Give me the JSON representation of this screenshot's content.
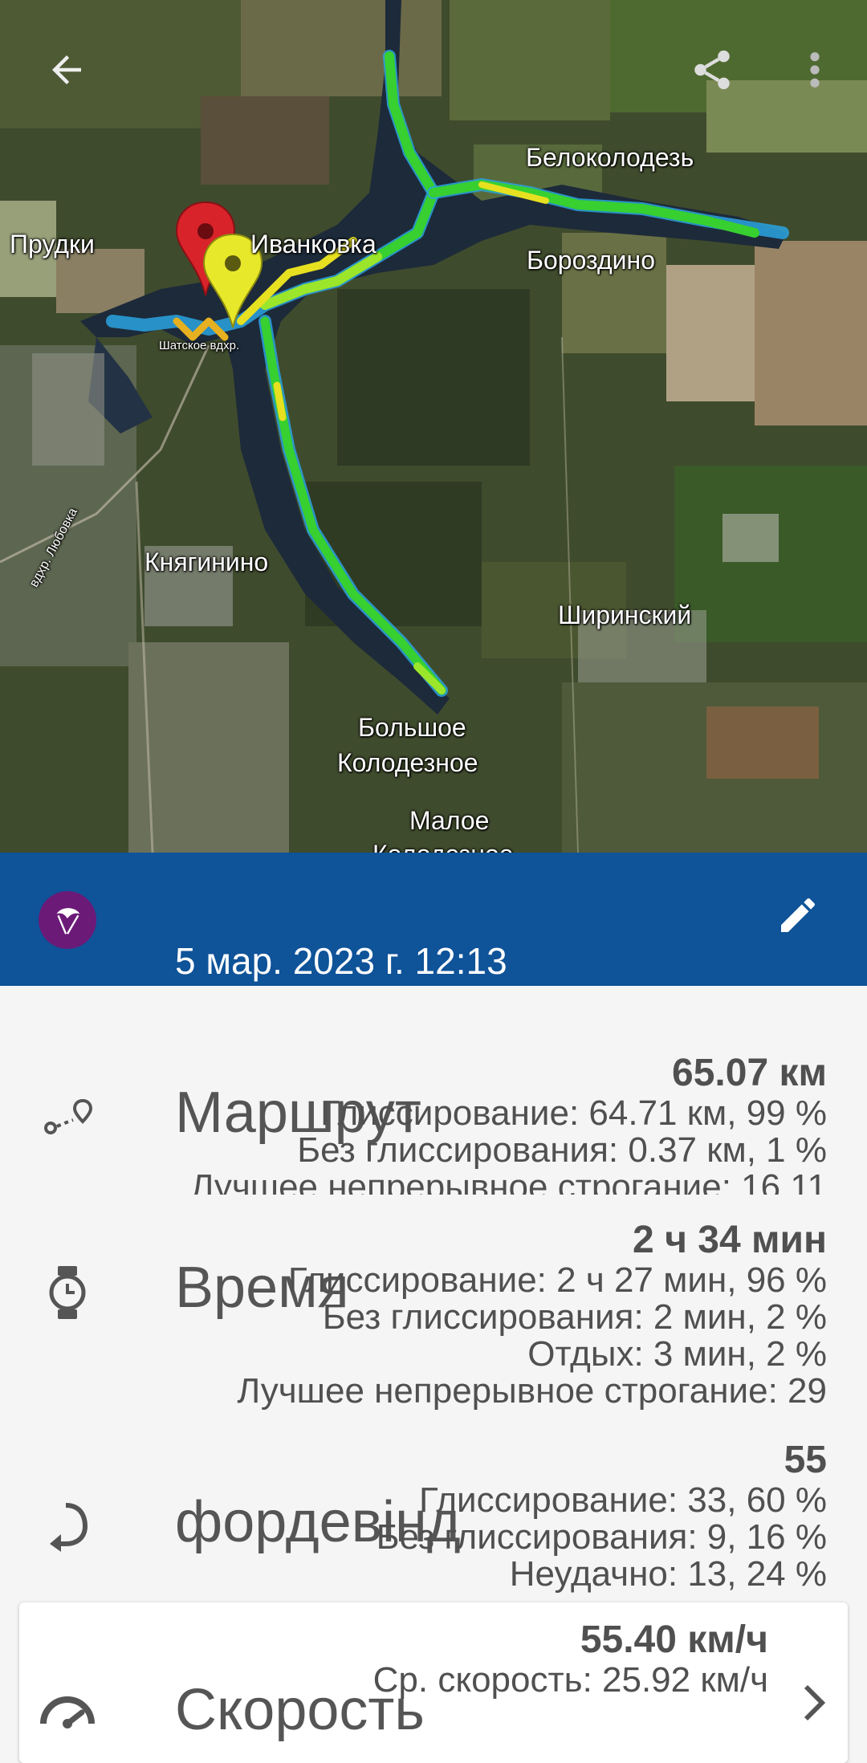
{
  "map": {
    "labels": {
      "prudki": "Прудки",
      "ivanovka": "Иванковка",
      "belokolodez": "Белоколодезь",
      "borozdino": "Бороздино",
      "shatskoe": "Шатское вдхр.",
      "knyaginino": "Княгинино",
      "shirinsky": "Ширинский",
      "bolshoe1": "Большое",
      "bolshoe2": "Колодезное",
      "maloe1": "Малое",
      "maloe2": "Колодезное",
      "lyubovka": "вдхр. Любовка"
    },
    "icons": {
      "back": "arrow-back-icon",
      "share": "share-icon",
      "menu": "more-vert-icon",
      "start_marker": "red-pin-icon",
      "end_marker": "yellow-pin-icon"
    },
    "track_colors": [
      "#2aa3e0",
      "#37d030",
      "#e6e020",
      "#9be62a"
    ]
  },
  "session": {
    "date": "5 мар. 2023 г. 12:13",
    "bar_color": "#0f5399",
    "avatar_icon": "kite-icon",
    "edit_icon": "pencil-icon"
  },
  "stats": {
    "route": {
      "title": "Маршрут",
      "icon": "route-icon",
      "main": "65.07 км",
      "lines": [
        "Глиссирование: 64.71 км, 99 %",
        "Без глиссирования: 0.37 км, 1 %",
        "Лучшее непрерывное строгание: 16.11"
      ]
    },
    "time": {
      "title": "Время",
      "icon": "watch-icon",
      "main": "2 ч 34 мин",
      "lines": [
        "Глиссирование: 2 ч 27 мин, 96 %",
        "Без глиссирования: 2 мин, 2 %",
        "Отдых: 3 мин, 2 %",
        "Лучшее непрерывное строгание: 29"
      ]
    },
    "jibe": {
      "title": "фордевінд",
      "icon": "turn-arrow-icon",
      "main": "55",
      "lines": [
        "Глиссирование: 33, 60 %",
        "Без глиссирования: 9, 16 %",
        "Неудачно: 13, 24 %"
      ]
    },
    "speed": {
      "title": "Скорость",
      "icon": "speedometer-icon",
      "main": "55.40 км/ч",
      "lines": [
        "Ср. скорость: 25.92 км/ч"
      ],
      "chevron_icon": "chevron-right-icon"
    }
  }
}
